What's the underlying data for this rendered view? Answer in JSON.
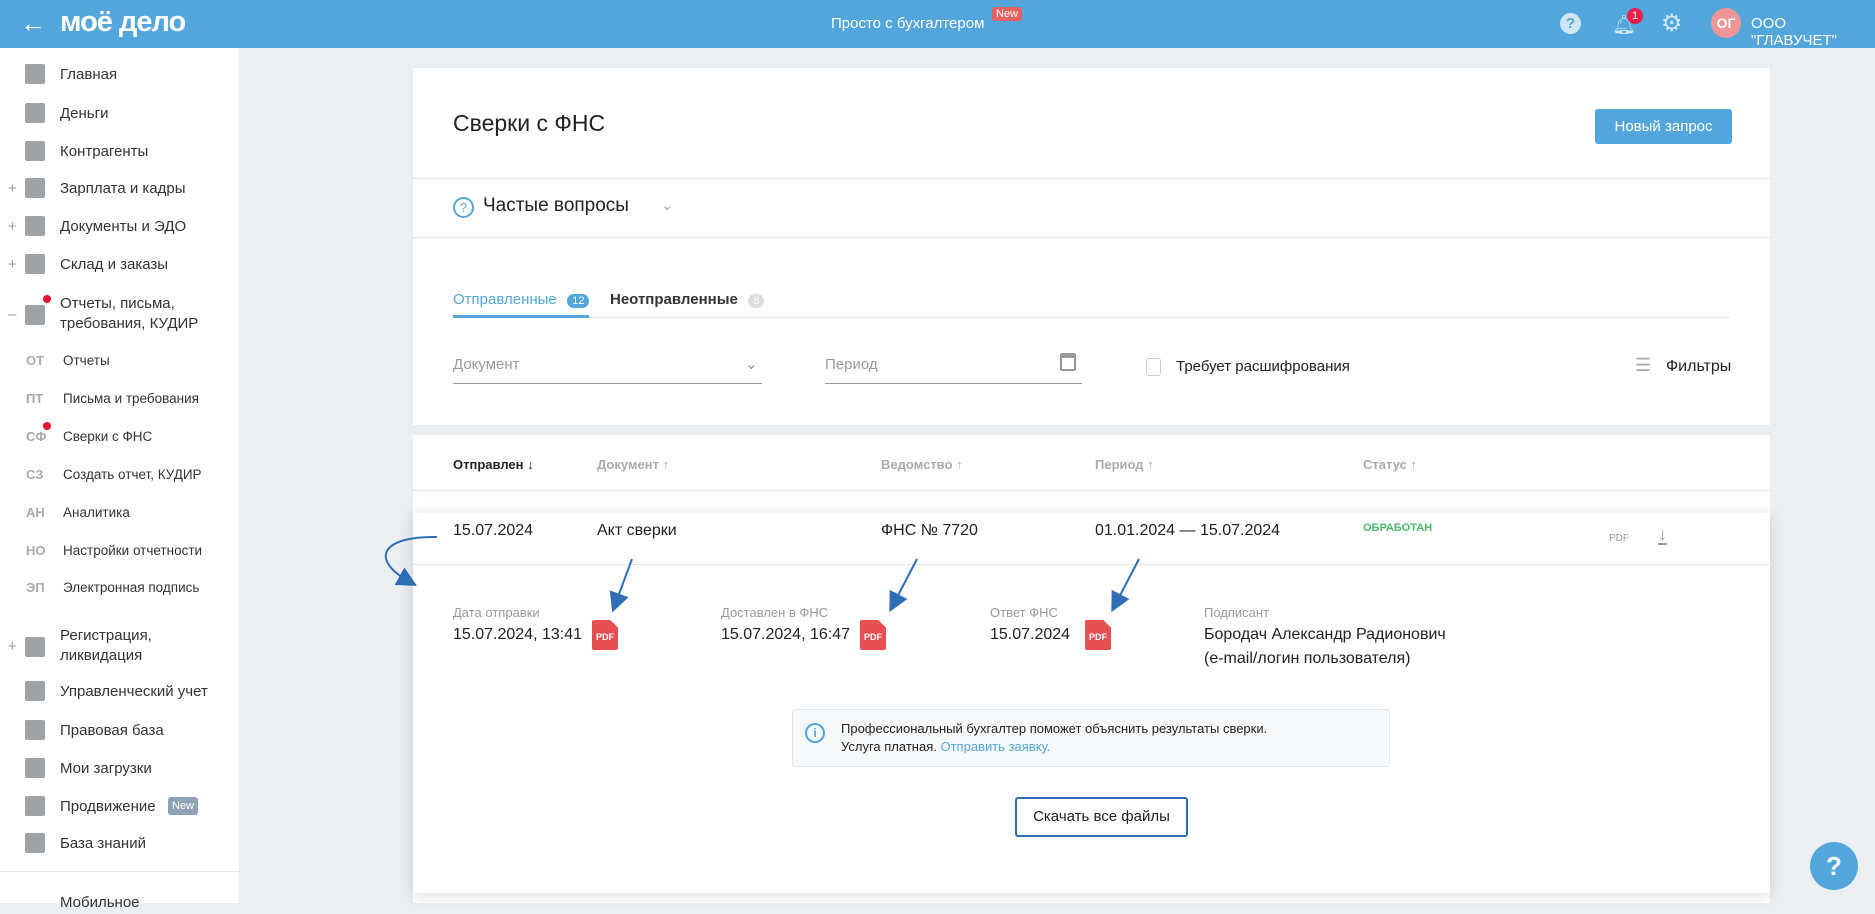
{
  "header": {
    "logo": "моё дело",
    "promo": "Просто с бухгалтером",
    "promo_badge": "New",
    "notif_count": "1",
    "avatar": "ОГ",
    "company": "ООО \"ГЛАВУЧЕТ\""
  },
  "sidebar": {
    "items": [
      {
        "label": "Главная",
        "icon": "home-icon"
      },
      {
        "label": "Деньги",
        "icon": "money-icon"
      },
      {
        "label": "Контрагенты",
        "icon": "contractors-icon"
      },
      {
        "label": "Зарплата и кадры",
        "icon": "salary-icon"
      },
      {
        "label": "Документы и ЭДО",
        "icon": "folder-icon"
      },
      {
        "label": "Склад и заказы",
        "icon": "warehouse-icon"
      },
      {
        "label": "Отчеты, письма,",
        "label2": "требования, КУДИР",
        "icon": "report-icon"
      },
      {
        "label": "Регистрация,",
        "label2": "ликвидация",
        "icon": "registration-icon"
      },
      {
        "label": "Управленческий учет",
        "icon": "management-icon"
      },
      {
        "label": "Правовая база",
        "icon": "briefcase-icon"
      },
      {
        "label": "Мои загрузки",
        "icon": "folder-icon"
      },
      {
        "label": "Продвижение",
        "badge": "New",
        "icon": "chart-icon"
      },
      {
        "label": "База знаний",
        "icon": "graduation-icon"
      },
      {
        "label": "Мобильное"
      }
    ],
    "subitems": [
      {
        "abbr": "ОТ",
        "label": "Отчеты"
      },
      {
        "abbr": "ПТ",
        "label": "Письма и требования"
      },
      {
        "abbr": "СФ",
        "label": "Сверки с ФНС"
      },
      {
        "abbr": "СЗ",
        "label": "Создать отчет, КУДИР"
      },
      {
        "abbr": "АН",
        "label": "Аналитика"
      },
      {
        "abbr": "НО",
        "label": "Настройки отчетности"
      },
      {
        "abbr": "ЭП",
        "label": "Электронная подпись"
      }
    ]
  },
  "page": {
    "title": "Сверки с ФНС",
    "new_request": "Новый запрос",
    "faq": "Частые вопросы",
    "tabs": [
      {
        "label": "Отправленные",
        "count": "12"
      },
      {
        "label": "Неотправленные",
        "count": "8"
      }
    ],
    "filters": {
      "document_placeholder": "Документ",
      "period_placeholder": "Период",
      "decrypt_label": "Требует расшифрования",
      "filters_label": "Фильтры"
    }
  },
  "table": {
    "headers": [
      "Отправлен ↓",
      "Документ ↑",
      "Ведомство ↑",
      "Период ↑",
      "Статус ↑"
    ],
    "row": {
      "sent": "15.07.2024",
      "document": "Акт сверки",
      "agency": "ФНС № 7720",
      "period": "01.01.2024 — 15.07.2024",
      "status": "ОБРАБОТАН",
      "pdf": "PDF"
    },
    "details": {
      "sent_label": "Дата отправки",
      "sent_value": "15.07.2024, 13:41",
      "delivered_label": "Доставлен в ФНС",
      "delivered_value": "15.07.2024, 16:47",
      "answer_label": "Ответ ФНС",
      "answer_value": "15.07.2024",
      "signer_label": "Подписант",
      "signer_name": "Бородач Александр Радионович",
      "signer_login": "(e-mail/логин пользователя)",
      "pdf": "PDF"
    },
    "info_text": "Профессиональный бухгалтер поможет объяснить результаты сверки.",
    "info_text2": "Услуга платная.",
    "info_link": "Отправить заявку.",
    "download_all": "Скачать все файлы"
  },
  "colors": {
    "header": "#53a6db",
    "status": "#4cba6a",
    "pdf": "#e84f53",
    "annotation": "#2f6db5"
  }
}
